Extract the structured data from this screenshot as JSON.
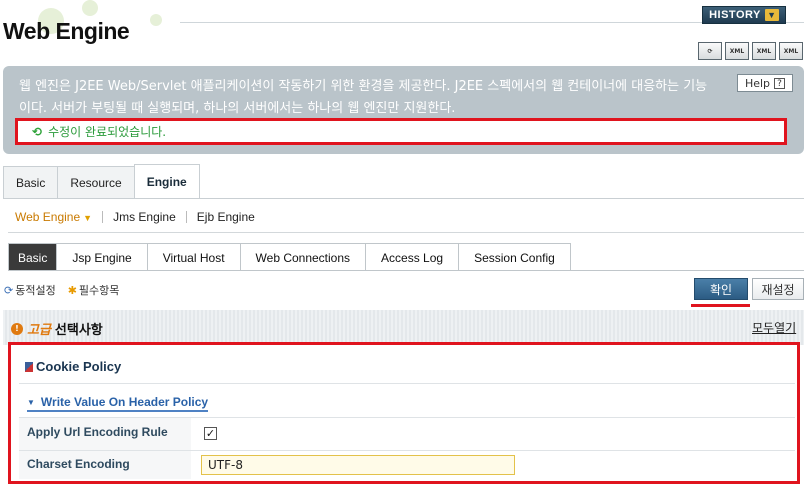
{
  "header": {
    "title": "Web Engine",
    "history_label": "HISTORY",
    "tool_icons": [
      "refresh-icon",
      "xml-export-icon",
      "xml-import-icon",
      "xml-view-icon"
    ]
  },
  "info": {
    "description": "웹 엔진은 J2EE Web/Servlet 애플리케이션이 작동하기 위한 환경을 제공한다. J2EE 스펙에서의 웹 컨테이너에 대응하는 기능이다. 서버가 부팅될 때 실행되며, 하나의 서버에서는 하나의 웹 엔진만 지원한다.",
    "help_label": "Help",
    "status_message": "수정이 완료되었습니다."
  },
  "top_tabs": [
    {
      "label": "Basic"
    },
    {
      "label": "Resource"
    },
    {
      "label": "Engine"
    }
  ],
  "sub_nav": [
    {
      "label": "Web Engine"
    },
    {
      "label": "Jms Engine"
    },
    {
      "label": "Ejb Engine"
    }
  ],
  "inner_tabs": [
    {
      "label": "Basic"
    },
    {
      "label": "Jsp Engine"
    },
    {
      "label": "Virtual Host"
    },
    {
      "label": "Web Connections"
    },
    {
      "label": "Access Log"
    },
    {
      "label": "Session Config"
    }
  ],
  "legend": {
    "dynamic": "동적설정",
    "required": "필수항목"
  },
  "buttons": {
    "confirm": "확인",
    "reset": "재설정"
  },
  "advanced": {
    "prefix": "고급",
    "title": "선택사항",
    "expand_all": "모두열기"
  },
  "cookie_policy": {
    "title": "Cookie Policy",
    "write_policy": "Write Value On Header Policy",
    "apply_url_encoding_label": "Apply Url Encoding Rule",
    "apply_url_encoding_check": "✓",
    "charset_label": "Charset Encoding",
    "charset_value": "UTF-8"
  },
  "colors": {
    "highlight": "#e0141e",
    "info_bg": "#bac4ca",
    "status_text": "#2a9a3a",
    "sub_nav_active": "#c97a00"
  }
}
